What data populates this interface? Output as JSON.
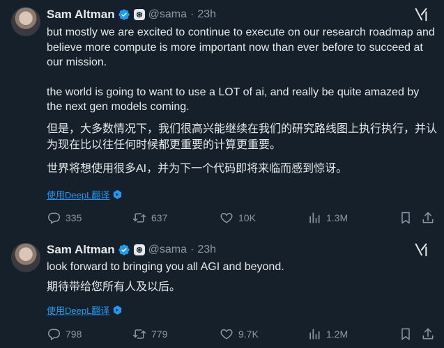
{
  "tweets": [
    {
      "author": "Sam Altman",
      "handle": "@sama",
      "dot": "·",
      "time": "23h",
      "paragraphs": [
        "but mostly we are excited to continue to execute on our research roadmap and believe more compute is more important now than ever before to succeed at our mission.",
        "the world is going to want to use a LOT of ai, and really be quite amazed by the next gen models coming.",
        "但是，大多数情况下，我们很高兴能继续在我们的研究路线图上执行执行，并认为现在比以往任何时候都更重要的计算更重要。",
        "世界将想使用很多AI，并为下一个代码即将来临而感到惊讶。"
      ],
      "translate_label": "使用DeepL翻译",
      "stats": {
        "replies": "335",
        "retweets": "637",
        "likes": "10K",
        "views": "1.3M"
      }
    },
    {
      "author": "Sam Altman",
      "handle": "@sama",
      "dot": "·",
      "time": "23h",
      "paragraphs": [
        "look forward to bringing you all AGI and beyond.",
        "期待带给您所有人及以后。"
      ],
      "translate_label": "使用DeepL翻译",
      "stats": {
        "replies": "798",
        "retweets": "779",
        "likes": "9.7K",
        "views": "1.2M"
      }
    }
  ],
  "colors": {
    "background": "#15202b",
    "text": "#e7e9ea",
    "muted": "#8b98a5",
    "link": "#1d9bf0",
    "verified": "#1d9bf0"
  }
}
